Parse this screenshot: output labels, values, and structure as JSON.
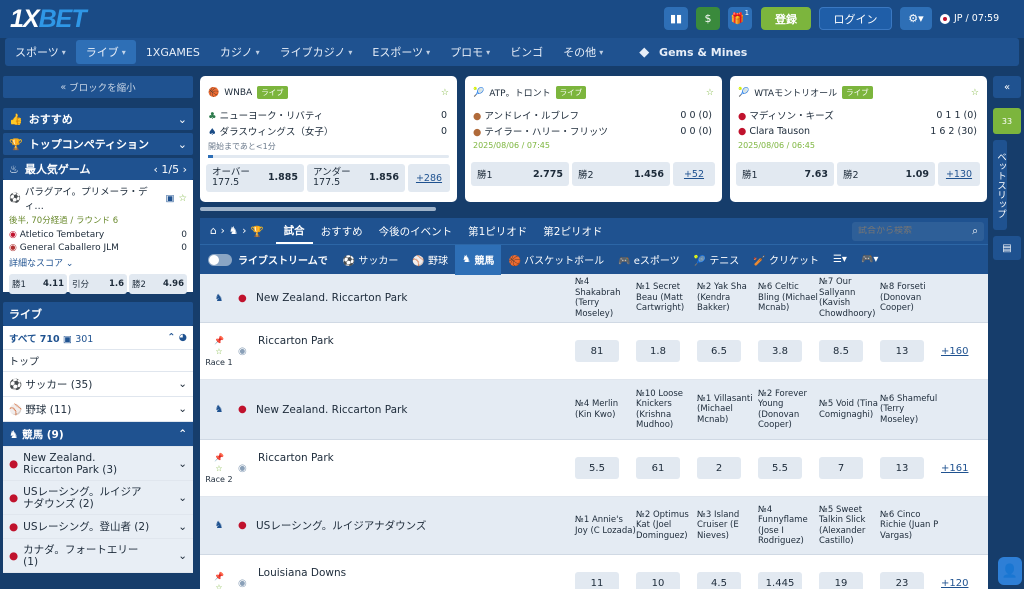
{
  "header": {
    "logo_a": "1X",
    "logo_b": "BET",
    "register": "登録",
    "login": "ログイン",
    "lang_time": "JP / 07:59",
    "gift_badge": "1",
    "colors": {
      "green": "#7cb53d",
      "blue": "#1a4b86"
    }
  },
  "nav": {
    "items": [
      "スポーツ",
      "ライブ",
      "1XGAMES",
      "カジノ",
      "ライブカジノ",
      "Eスポーツ",
      "プロモ",
      "ビンゴ",
      "その他"
    ],
    "gems": "Gems & Mines"
  },
  "left": {
    "collapse": "ブロックを縮小",
    "recommended": "おすすめ",
    "top_comp": "トップコンペティション",
    "popular": "最人気ゲーム",
    "popular_page": "1/5",
    "match_league": "パラグアイ。プリメーラ・ディ…",
    "match_status": "後半, 70分経過 / ラウンド",
    "match_round": "6",
    "team1": "Atletico Tembetary",
    "team1_score": "0",
    "team2": "General Caballero JLM",
    "team2_score": "0",
    "more_score": "詳細なスコア",
    "odds": [
      {
        "label": "勝1",
        "val": "4.11"
      },
      {
        "label": "引分",
        "val": "1.6"
      },
      {
        "label": "勝2",
        "val": "4.96"
      }
    ],
    "live": "ライブ",
    "all": "すべて 710",
    "all_video": "301",
    "top": "トップ",
    "sports": [
      {
        "name": "サッカー (35)"
      },
      {
        "name": "野球 (11)"
      },
      {
        "name": "競馬 (9)"
      },
      {
        "name": "New Zealand. Riccarton Park (3)"
      },
      {
        "name": "USレーシング。ルイジアナダウンズ (2)"
      },
      {
        "name": "USレーシング。登山者 (2)"
      },
      {
        "name": "カナダ。フォートエリー (1)"
      }
    ]
  },
  "events": [
    {
      "league": "WNBA",
      "tag": "ライブ",
      "t1": "ニューヨーク・リバティ",
      "s1": "0",
      "t2": "ダラスウィングス（女子）",
      "s2": "0",
      "info": "開始まであと<1分",
      "o1l": "オーバー 177.5",
      "o1v": "1.885",
      "o2l": "アンダー 177.5",
      "o2v": "1.856",
      "more": "+286"
    },
    {
      "league": "ATP。トロント",
      "tag": "ライブ",
      "t1": "アンドレイ・ルブレフ",
      "s1": "0 0 (0)",
      "t2": "テイラー・ハリー・フリッツ",
      "s2": "0 0 (0)",
      "info": "2025/08/06 / 07:45",
      "o1l": "勝1",
      "o1v": "2.775",
      "o2l": "勝2",
      "o2v": "1.456",
      "more": "+52"
    },
    {
      "league": "WTAモントリオール",
      "tag": "ライブ",
      "t1": "マディソン・キーズ",
      "s1": "0 1 1 (0)",
      "t2": "Clara Tauson",
      "s2": "1 6 2 (30)",
      "info": "2025/08/06 / 06:45",
      "o1l": "勝1",
      "o1v": "7.63",
      "o2l": "勝2",
      "o2v": "1.09",
      "more": "+130"
    }
  ],
  "main": {
    "tabs": [
      "試合",
      "おすすめ",
      "今後のイベント",
      "第1ピリオド",
      "第2ピリオド"
    ],
    "search_placeholder": "試合から検索",
    "stream": "ライブストリームで",
    "sports": [
      "サッカー",
      "野球",
      "競馬",
      "バスケットボール",
      "eスポーツ",
      "テニス",
      "クリケット"
    ],
    "groups": [
      {
        "title": "New Zealand. Riccarton Park",
        "runners": [
          "№4 Shakabrah (Terry Moseley)",
          "№1 Secret Beau (Matt Cartwright)",
          "№2 Yak Sha (Kendra Bakker)",
          "№6 Celtic Bling (Michael Mcnab)",
          "№7 Our Sallyann (Kavish Chowdhoory)",
          "№8 Forseti (Donovan Cooper)"
        ],
        "venue": "Riccarton Park",
        "race": "Race 1",
        "odds": [
          "81",
          "1.8",
          "6.5",
          "3.8",
          "8.5",
          "13"
        ],
        "more": "+160"
      },
      {
        "title": "New Zealand. Riccarton Park",
        "runners": [
          "№4 Merlin (Kin Kwo)",
          "№10 Loose Knickers (Krishna Mudhoo)",
          "№1 Villasanti (Michael Mcnab)",
          "№2 Forever Young (Donovan Cooper)",
          "№5 Void (Tina Comignaghi)",
          "№6 Shameful (Terry Moseley)"
        ],
        "venue": "Riccarton Park",
        "race": "Race 2",
        "odds": [
          "5.5",
          "61",
          "2",
          "5.5",
          "7",
          "13"
        ],
        "more": "+161"
      },
      {
        "title": "USレーシング。ルイジアナダウンズ",
        "runners": [
          "№1 Annie's Joy (C Lozada)",
          "№2 Optimus Kat (Joel Dominguez)",
          "№3 Island Cruiser (E Nieves)",
          "№4 Funnyflame (Jose I Rodriguez)",
          "№5 Sweet Talkin Slick (Alexander Castillo)",
          "№6 Cinco Richie (Juan P Vargas)"
        ],
        "venue": "Louisiana Downs",
        "race": "",
        "odds": [
          "11",
          "10",
          "4.5",
          "1.445",
          "19",
          "23"
        ],
        "more": "+120"
      }
    ]
  },
  "right": {
    "bet_tag": "33",
    "betslip": "ベットスリップ"
  }
}
